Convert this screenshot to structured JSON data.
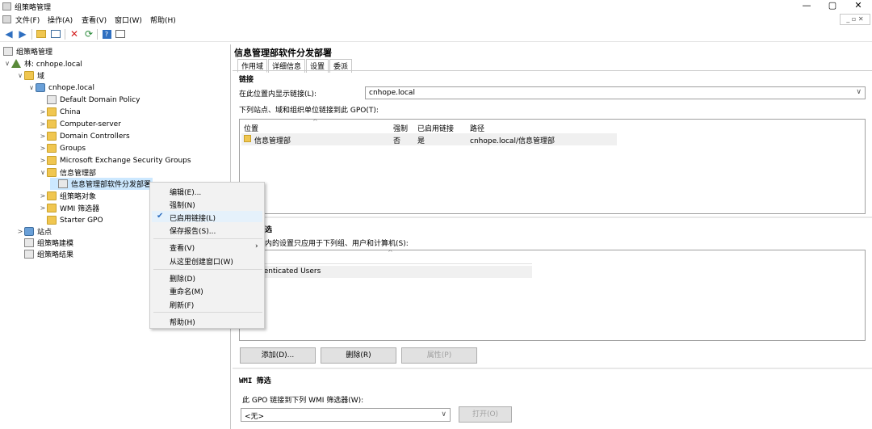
{
  "window": {
    "title": "组策略管理",
    "controls": [
      "—",
      "▢",
      "✕"
    ],
    "inner_controls": "_ ▫ ✕"
  },
  "menu": [
    "文件(F)",
    "操作(A)",
    "查看(V)",
    "窗口(W)",
    "帮助(H)"
  ],
  "toolbar": {
    "back_icon": "back-arrow-icon",
    "forward_icon": "forward-arrow-icon"
  },
  "tree": {
    "root": "组策略管理",
    "forest": "林: cnhope.local",
    "domains": "域",
    "domain": "cnhope.local",
    "items": [
      "Default Domain Policy",
      "China",
      "Computer-server",
      "Domain Controllers",
      "Groups",
      "Microsoft Exchange Security Groups",
      "信息管理部"
    ],
    "selected": "信息管理部软件分发部署",
    "after": [
      "组策略对象",
      "WMI 筛选器",
      "Starter GPO"
    ],
    "sites": "站点",
    "modeling": "组策略建模",
    "results": "组策略结果"
  },
  "context_menu": {
    "edit": "编辑(E)...",
    "enforce": "强制(N)",
    "link_enabled": "已启用链接(L)",
    "save_report": "保存报告(S)...",
    "view": "查看(V)",
    "new_window": "从这里创建窗口(W)",
    "delete": "删除(D)",
    "rename": "重命名(M)",
    "refresh": "刷新(F)",
    "help": "帮助(H)"
  },
  "details": {
    "title": "信息管理部软件分发部署",
    "tabs": [
      "作用域",
      "详细信息",
      "设置",
      "委派"
    ],
    "links_heading": "链接",
    "display_label": "在此位置内显示链接(L):",
    "display_value": "cnhope.local",
    "linked_label": "下列站点、域和组织单位链接到此 GPO(T):",
    "links_columns": [
      "位置",
      "强制",
      "已启用链接",
      "路径"
    ],
    "links_rows": [
      {
        "location": "信息管理部",
        "enforced": "否",
        "enabled": "是",
        "path": "cnhope.local/信息管理部"
      }
    ],
    "security_heading": "选",
    "security_label": "内的设置只应用于下列组、用户和计算机(S):",
    "security_rows": [
      "henticated Users"
    ],
    "buttons": {
      "add": "添加(D)...",
      "remove": "删除(R)",
      "properties": "属性(P)"
    },
    "wmi_heading": "WMI 筛选",
    "wmi_label": "此 GPO 链接到下列 WMI 筛选器(W):",
    "wmi_value": "<无>",
    "wmi_open": "打开(O)"
  }
}
